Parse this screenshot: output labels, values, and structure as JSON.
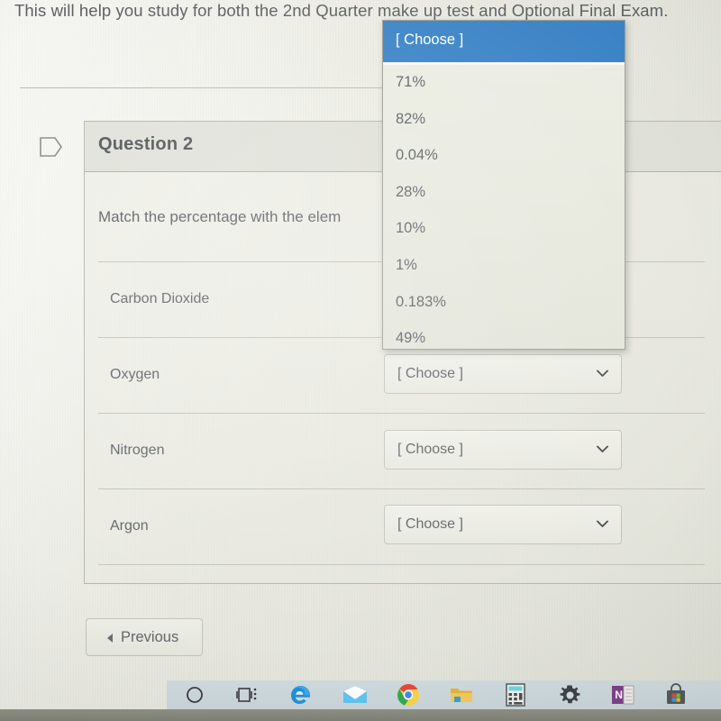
{
  "instruction": {
    "text": "This will help you study for both the 2nd Quarter make up test and Optional Final Exam."
  },
  "question_card": {
    "flag_icon": "flag-outline-icon",
    "header_title": "Question 2",
    "prompt": "Match the percentage with the elem",
    "rows": [
      {
        "label": "Carbon Dioxide",
        "select_value": "[ Choose ]"
      },
      {
        "label": "Oxygen",
        "select_value": "[ Choose ]"
      },
      {
        "label": "Nitrogen",
        "select_value": "[ Choose ]"
      },
      {
        "label": "Argon",
        "select_value": "[ Choose ]"
      }
    ]
  },
  "dropdown": {
    "open": true,
    "highlight_color": "#3b83c6",
    "selected_label": "[ Choose ]",
    "options": [
      "71%",
      "82%",
      "0.04%",
      "28%",
      "10%",
      "1%",
      "0.183%",
      "49%"
    ]
  },
  "navigation": {
    "previous_label": "Previous",
    "previous_icon": "caret-left-icon"
  },
  "taskbar": {
    "items": [
      {
        "name": "cortana-icon",
        "label": "Cortana"
      },
      {
        "name": "task-view-icon",
        "label": "Task View"
      },
      {
        "name": "edge-icon",
        "label": "Microsoft Edge"
      },
      {
        "name": "mail-icon",
        "label": "Mail"
      },
      {
        "name": "chrome-icon",
        "label": "Google Chrome"
      },
      {
        "name": "file-explorer-icon",
        "label": "File Explorer"
      },
      {
        "name": "calculator-icon",
        "label": "Calculator"
      },
      {
        "name": "settings-gear-icon",
        "label": "Settings"
      },
      {
        "name": "onenote-icon",
        "label": "OneNote"
      },
      {
        "name": "microsoft-store-icon",
        "label": "Microsoft Store"
      }
    ]
  }
}
